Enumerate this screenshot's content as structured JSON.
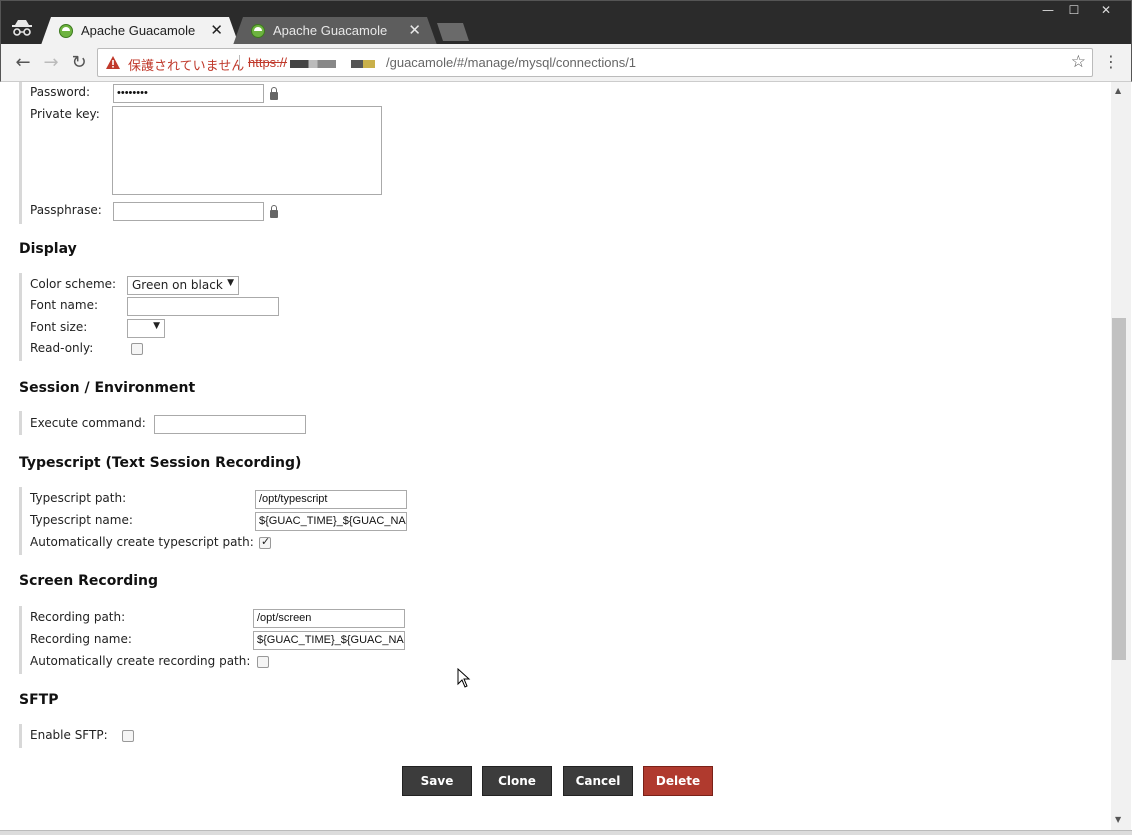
{
  "browser": {
    "tabs": [
      {
        "title": "Apache Guacamole",
        "active": true
      },
      {
        "title": "Apache Guacamole",
        "active": false
      }
    ],
    "window_controls": {
      "minimize": "—",
      "maximize": "☐",
      "close": "✕"
    },
    "nav": {
      "back": "←",
      "forward": "→",
      "reload": "↻"
    },
    "address": {
      "security_label": "保護されていません",
      "scheme": "https://",
      "path": "/guacamole/#/manage/mysql/connections/1"
    }
  },
  "form": {
    "auth": {
      "password_label": "Password:",
      "password_value": "••••••••",
      "private_key_label": "Private key:",
      "passphrase_label": "Passphrase:"
    },
    "display": {
      "title": "Display",
      "color_scheme_label": "Color scheme:",
      "color_scheme_value": "Green on black",
      "font_name_label": "Font name:",
      "font_size_label": "Font size:",
      "read_only_label": "Read-only:"
    },
    "session": {
      "title": "Session / Environment",
      "execute_command_label": "Execute command:"
    },
    "typescript": {
      "title": "Typescript (Text Session Recording)",
      "path_label": "Typescript path:",
      "path_value": "/opt/typescript",
      "name_label": "Typescript name:",
      "name_value": "${GUAC_TIME}_${GUAC_NA",
      "auto_create_label": "Automatically create typescript path:",
      "auto_create_checked": true
    },
    "recording": {
      "title": "Screen Recording",
      "path_label": "Recording path:",
      "path_value": "/opt/screen",
      "name_label": "Recording name:",
      "name_value": "${GUAC_TIME}_${GUAC_NA",
      "auto_create_label": "Automatically create recording path:",
      "auto_create_checked": false
    },
    "sftp": {
      "title": "SFTP",
      "enable_label": "Enable SFTP:",
      "enable_checked": false
    }
  },
  "actions": {
    "save": "Save",
    "clone": "Clone",
    "cancel": "Cancel",
    "delete": "Delete"
  },
  "colors": {
    "delete_button": "#b03a2e",
    "button_dark": "#3c3c3c",
    "insecure_warning": "#c0392b"
  }
}
